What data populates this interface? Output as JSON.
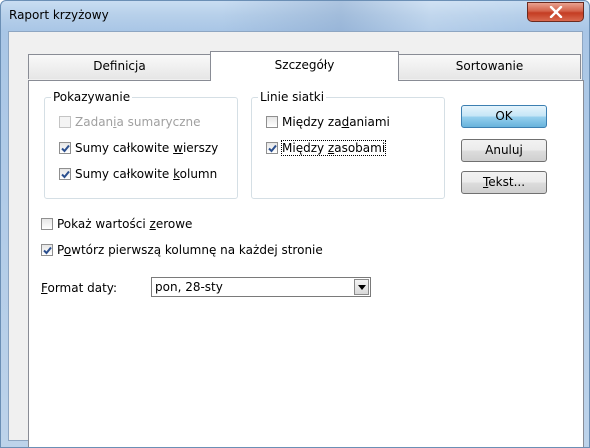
{
  "window": {
    "title": "Raport krzyżowy"
  },
  "tabs": [
    {
      "label": "Definicja",
      "selected": false
    },
    {
      "label": "Szczegóły",
      "selected": true
    },
    {
      "label": "Sortowanie",
      "selected": false
    }
  ],
  "show_group": {
    "legend": "Pokazywanie",
    "items": [
      {
        "pre": "Zadan",
        "acc": "i",
        "post": "a sumaryczne",
        "checked": false,
        "disabled": true
      },
      {
        "pre": "Sumy całkowite ",
        "acc": "w",
        "post": "ierszy",
        "checked": true,
        "disabled": false
      },
      {
        "pre": "Sumy całkowite ",
        "acc": "k",
        "post": "olumn",
        "checked": true,
        "disabled": false
      }
    ]
  },
  "grid_group": {
    "legend": "Linie siatki",
    "items": [
      {
        "pre": "Między za",
        "acc": "d",
        "post": "aniami",
        "checked": false
      },
      {
        "pre": "Między ",
        "acc": "z",
        "post": "asobami",
        "checked": true
      }
    ]
  },
  "options": {
    "zero": {
      "pre": "Pokaż wartości ",
      "acc": "z",
      "post": "erowe",
      "checked": false
    },
    "repeat": {
      "pre": "P",
      "acc": "o",
      "post": "wtórz pierwszą kolumnę na każdej stronie",
      "checked": true
    }
  },
  "date_format": {
    "label_acc": "F",
    "label_rest": "ormat daty:",
    "value": "pon, 28-sty"
  },
  "buttons": {
    "ok": "OK",
    "cancel": "Anuluj",
    "text_acc": "T",
    "text_rest": "ekst..."
  },
  "colors": {
    "accent": "#3c7fb1",
    "close": "#c43c22",
    "check": "#2b4f8e"
  }
}
